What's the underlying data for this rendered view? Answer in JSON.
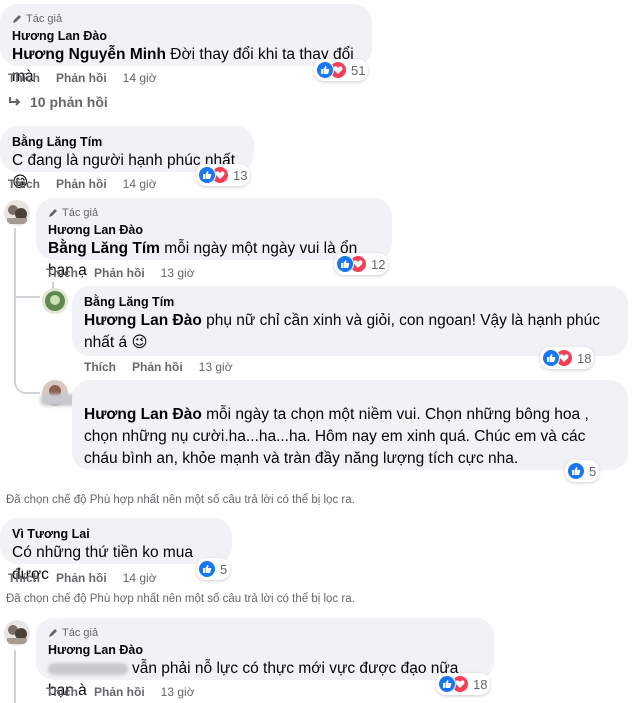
{
  "author_badge": "Tác giả",
  "actions": {
    "like": "Thích",
    "reply": "Phản hồi"
  },
  "comments": [
    {
      "author": "Hương Lan Đào",
      "mention": "Hương Nguyễn Minh",
      "text": " Đời thay đổi khi ta thay đổi mà",
      "time": "14 giờ",
      "reactions": "51"
    },
    {
      "author": "Bằng Lăng Tím",
      "text": "C đang là người hạnh phúc nhất 😁",
      "time": "14 giờ",
      "reactions": "13"
    },
    {
      "author": "Hương Lan Đào",
      "mention": "Bằng Lăng Tím",
      "text": " mỗi ngày một ngày vui là ổn bạn ạ",
      "time": "13 giờ",
      "reactions": "12"
    },
    {
      "author": "Bằng Lăng Tím",
      "mention": "Hương Lan Đào",
      "text": " phụ nữ chỉ cần xinh và giỏi, con ngoan! Vậy là hạnh phúc nhất á 😉",
      "time": "13 giờ",
      "reactions": "18"
    },
    {
      "mention": "Hương Lan Đào",
      "text": " mỗi ngày ta chọn một niềm vui. Chọn những bông hoa , chọn những nụ cười.ha...ha...ha. Hôm nay em xinh quá. Chúc em và các cháu bình an, khỏe mạnh và tràn đầy năng lượng tích cực nha.",
      "reactions": "5"
    },
    {
      "author": "Vì Tương Lai",
      "text": "Có những thứ tiền ko mua được",
      "time": "14 giờ",
      "reactions": "5"
    },
    {
      "author": "Hương Lan Đào",
      "text": "vẫn phải nỗ lực có thực mới vực được đạo nữa bạn à",
      "time": "13 giờ",
      "reactions": "18"
    }
  ],
  "more_replies": "10 phản hồi",
  "filter_notice": "Đã chọn chế độ Phù hợp nhất nên một số câu trả lời có thể bị lọc ra."
}
